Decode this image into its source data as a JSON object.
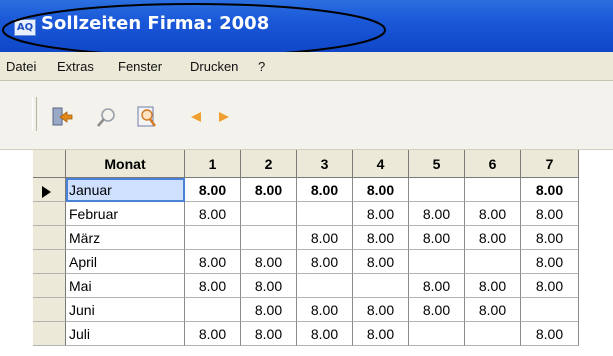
{
  "window": {
    "app_icon": "AQ",
    "title": "Sollzeiten Firma: 2008"
  },
  "menu": [
    "Datei",
    "Extras",
    "Fenster",
    "Drucken",
    "?"
  ],
  "toolbar": {
    "buttons": [
      "exit-door-icon",
      "search-icon",
      "preview-icon",
      "prev-arrow-icon",
      "next-arrow-icon"
    ],
    "colors": {
      "exit": "#d98a1a",
      "arrow": "#f0a030"
    }
  },
  "table": {
    "columns": [
      "Monat",
      "1",
      "2",
      "3",
      "4",
      "5",
      "6",
      "7"
    ],
    "selected_row": 0,
    "rows": [
      {
        "month": "Januar",
        "cells": [
          "8.00",
          "8.00",
          "8.00",
          "8.00",
          "",
          "",
          "8.00"
        ]
      },
      {
        "month": "Februar",
        "cells": [
          "8.00",
          "",
          "",
          "8.00",
          "8.00",
          "8.00",
          "8.00"
        ]
      },
      {
        "month": "März",
        "cells": [
          "",
          "",
          "8.00",
          "8.00",
          "8.00",
          "8.00",
          "8.00"
        ]
      },
      {
        "month": "April",
        "cells": [
          "8.00",
          "8.00",
          "8.00",
          "8.00",
          "",
          "",
          "8.00"
        ]
      },
      {
        "month": "Mai",
        "cells": [
          "8.00",
          "8.00",
          "",
          "",
          "8.00",
          "8.00",
          "8.00"
        ]
      },
      {
        "month": "Juni",
        "cells": [
          "",
          "8.00",
          "8.00",
          "8.00",
          "8.00",
          "8.00",
          ""
        ]
      },
      {
        "month": "Juli",
        "cells": [
          "8.00",
          "8.00",
          "8.00",
          "8.00",
          "",
          "",
          "8.00"
        ]
      }
    ]
  }
}
